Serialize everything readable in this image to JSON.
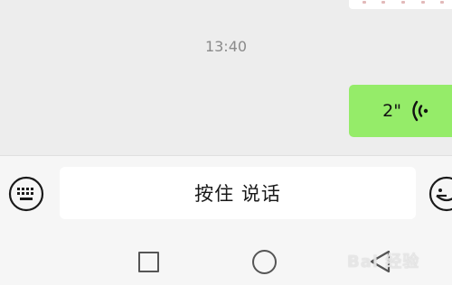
{
  "chat": {
    "timestamp": "13:40",
    "voice_message": {
      "duration": "2\"",
      "icon": "voice-wave-icon"
    }
  },
  "input_bar": {
    "keyboard_icon": "keyboard-icon",
    "hold_to_talk_label": "按住 说话",
    "emoji_icon": "emoji-icon"
  },
  "nav_bar": {
    "recent_icon": "square-icon",
    "home_icon": "circle-icon",
    "back_icon": "triangle-back-icon"
  },
  "watermark": {
    "text": "Bai 经验"
  },
  "colors": {
    "chat_background": "#ededed",
    "voice_bubble": "#95ec69",
    "input_bar": "#f6f6f6",
    "timestamp": "#8a8a8a"
  }
}
